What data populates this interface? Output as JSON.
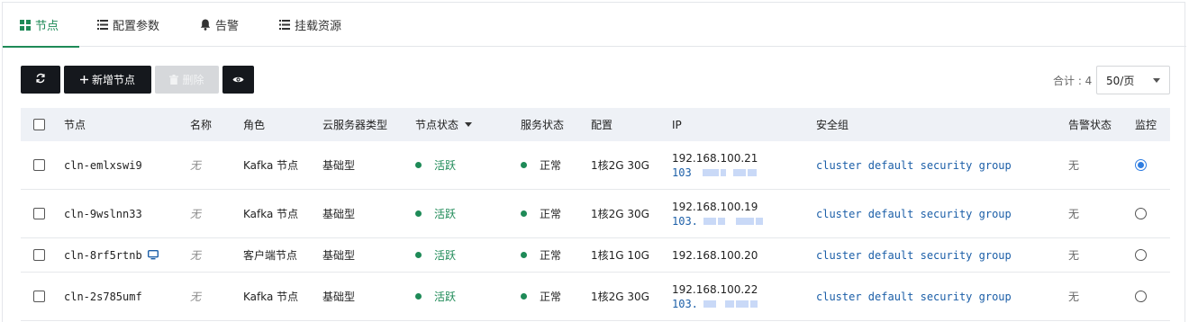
{
  "tabs": [
    {
      "label": "节点",
      "icon": "grid-icon",
      "active": true
    },
    {
      "label": "配置参数",
      "icon": "list-icon"
    },
    {
      "label": "告警",
      "icon": "bell-icon"
    },
    {
      "label": "挂载资源",
      "icon": "list-icon"
    }
  ],
  "toolbar": {
    "refresh_icon": "refresh-icon",
    "add_label": "新增节点",
    "delete_label": "删除",
    "view_icon": "eye-icon"
  },
  "pagination": {
    "total_label": "合计 : 4",
    "page_size": "50/页"
  },
  "table": {
    "headers": {
      "node": "节点",
      "name": "名称",
      "role": "角色",
      "type": "云服务器类型",
      "node_status": "节点状态",
      "service_status": "服务状态",
      "config": "配置",
      "ip": "IP",
      "security_group": "安全组",
      "alarm_status": "告警状态",
      "monitor": "监控"
    },
    "rows": [
      {
        "node": "cln-emlxswi9",
        "name": "无",
        "role": "Kafka 节点",
        "type": "基础型",
        "node_status": "活跃",
        "service_status": "正常",
        "config": "1核2G 30G",
        "ip": "192.168.100.21",
        "public_ip": "103",
        "security_group": "cluster default security group",
        "alarm": "无",
        "monitor_selected": true
      },
      {
        "node": "cln-9wslnn33",
        "name": "无",
        "role": "Kafka 节点",
        "type": "基础型",
        "node_status": "活跃",
        "service_status": "正常",
        "config": "1核2G 30G",
        "ip": "192.168.100.19",
        "public_ip": "103.",
        "security_group": "cluster default security group",
        "alarm": "无",
        "monitor_selected": false
      },
      {
        "node": "cln-8rf5rtnb",
        "name": "无",
        "role": "客户端节点",
        "type": "基础型",
        "node_status": "活跃",
        "service_status": "正常",
        "config": "1核1G 10G",
        "ip": "192.168.100.20",
        "public_ip": "",
        "security_group": "cluster default security group",
        "alarm": "无",
        "monitor_selected": false,
        "has_vnc_icon": true
      },
      {
        "node": "cln-2s785umf",
        "name": "无",
        "role": "Kafka 节点",
        "type": "基础型",
        "node_status": "活跃",
        "service_status": "正常",
        "config": "1核2G 30G",
        "ip": "192.168.100.22",
        "public_ip": "103.",
        "security_group": "cluster default security group",
        "alarm": "无",
        "monitor_selected": false
      }
    ]
  },
  "colors": {
    "accent_green": "#1e8a57",
    "link_blue": "#1c5fa8",
    "radio_blue": "#2f7de1",
    "button_dark": "#15181d",
    "header_bg": "#eef1f6"
  }
}
